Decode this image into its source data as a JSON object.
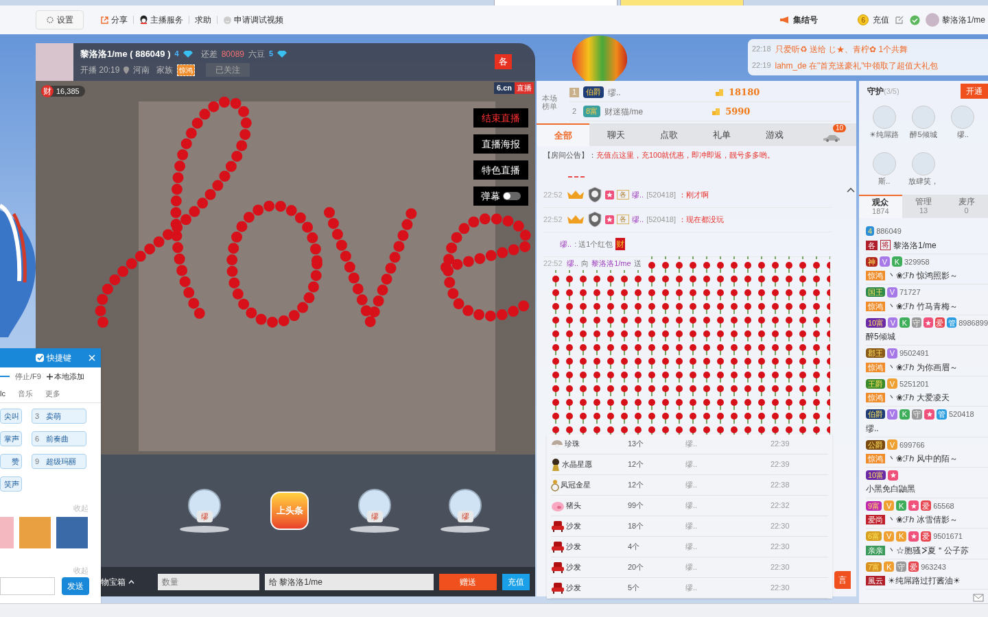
{
  "top_nav": {
    "settings": "设置",
    "links": [
      {
        "kind": "share",
        "label": "分享"
      },
      {
        "kind": "service",
        "label": "主播服务"
      },
      {
        "kind": "plain",
        "label": "求助"
      },
      {
        "kind": "smile",
        "label": "申请调试视频"
      }
    ],
    "rally": "集结号",
    "coin": "6",
    "recharge": "充值",
    "user": "黎洛洛1/me"
  },
  "host": {
    "name": "黎洛洛1/me ( 886049 )",
    "level": "4",
    "gap_label": "还差",
    "gap_value": "80089",
    "gap_unit": "六豆",
    "next_level": "5",
    "start": "开播 20:19",
    "location": "河南",
    "family_label": "家族",
    "family": "惊鸿",
    "follow": "已关注",
    "flag": "各"
  },
  "notifications": [
    {
      "time": "22:18",
      "text": "只爱听♻ 送给 じ★、青柠✿ 1个共舞"
    },
    {
      "time": "22:19",
      "text": "lahm_de 在\"首充送豪礼\"中领取了超值大礼包"
    }
  ],
  "video": {
    "fans_badge": "财",
    "fans": "16,385",
    "logo": "6.cn",
    "logo_tag": "直播",
    "buttons": [
      {
        "label": "结束直播",
        "kind": "red"
      },
      {
        "label": "直播海报",
        "kind": "plain"
      },
      {
        "label": "特色直播",
        "kind": "plain"
      },
      {
        "label": "弹幕",
        "kind": "toggle",
        "on": false
      }
    ]
  },
  "stage": [
    {
      "kind": "avatar",
      "label": "缪"
    },
    {
      "kind": "headline",
      "label": "上头条"
    },
    {
      "kind": "avatar",
      "label": "缪"
    },
    {
      "kind": "avatar",
      "label": "缪"
    }
  ],
  "gift_bar": {
    "box": "物宝箱",
    "quantity_placeholder": "数量",
    "recipient": "给 黎洛洛1/me",
    "send": "赠送",
    "recharge": "充值"
  },
  "ranking": {
    "label": "本场榜单",
    "rows": [
      {
        "rank": "1",
        "badge": {
          "text": "伯爵",
          "color": "#1d3c78"
        },
        "name": "缪..",
        "score": "18180"
      },
      {
        "rank": "2",
        "badge": {
          "text": "8富",
          "color": "#3aa0a0"
        },
        "name": "财迷猫/me",
        "score": "5990"
      }
    ]
  },
  "chat_tabs": [
    {
      "label": "全部",
      "selected": true
    },
    {
      "label": "聊天",
      "selected": false
    },
    {
      "label": "点歌",
      "selected": false
    },
    {
      "label": "礼单",
      "selected": false
    },
    {
      "label": "游戏",
      "selected": false
    }
  ],
  "car_count": "10",
  "announcement": {
    "label": "【房间公告】：",
    "text": "充值点这里，充100就优惠，即冲即返，靓号多多哟。"
  },
  "messages": [
    {
      "kind": "chat",
      "time": "22:52",
      "family": "各",
      "name": "缪..",
      "id": "[520418]",
      "text": "：刚才啊"
    },
    {
      "kind": "chat",
      "time": "22:52",
      "family": "各",
      "name": "缪..",
      "id": "[520418]",
      "text": "：现在都没玩"
    },
    {
      "kind": "redpacket",
      "name": "缪..",
      "text": ": 送1个红包",
      "badge": "财"
    },
    {
      "kind": "gift",
      "time": "22:52",
      "name": "缪..",
      "verb": "向",
      "target": "黎洛洛1/me",
      "text": "送"
    }
  ],
  "send_button": "言",
  "gift_list": [
    {
      "kind": "pearl",
      "name": "珍珠",
      "count": "13个",
      "from": "缪..",
      "time": "22:39"
    },
    {
      "kind": "figure",
      "name": "水晶星愿",
      "count": "12个",
      "from": "缪..",
      "time": "22:39"
    },
    {
      "kind": "ring",
      "name": "凤冠金星",
      "count": "12个",
      "from": "缪..",
      "time": "22:38"
    },
    {
      "kind": "pig",
      "name": "猪头",
      "count": "99个",
      "from": "缪..",
      "time": "22:32"
    },
    {
      "kind": "sofa",
      "name": "沙发",
      "count": "18个",
      "from": "缪..",
      "time": "22:30"
    },
    {
      "kind": "sofa",
      "name": "沙发",
      "count": "4个",
      "from": "缪..",
      "time": "22:30"
    },
    {
      "kind": "sofa",
      "name": "沙发",
      "count": "20个",
      "from": "缪..",
      "time": "22:30"
    },
    {
      "kind": "sofa",
      "name": "沙发",
      "count": "5个",
      "from": "缪..",
      "time": "22:30"
    }
  ],
  "guards": {
    "title": "守护",
    "count": "(3/5)",
    "open": "开通",
    "members": [
      "☀纯屌路",
      "醉5倾城",
      "缪..",
      "斯..",
      "放肆笑，"
    ]
  },
  "audience_tabs": [
    {
      "label": "观众",
      "count": "1874",
      "selected": true
    },
    {
      "label": "管理",
      "count": "13",
      "selected": false
    },
    {
      "label": "麦序",
      "count": "0",
      "selected": false
    }
  ],
  "users": [
    {
      "rank": {
        "text": "4",
        "color": "#2a8fd8"
      },
      "id": "886049",
      "family": {
        "text": "各",
        "color": "#b01e2a"
      },
      "title": "将",
      "name": [
        {
          "text": "黎洛洛1/me"
        }
      ]
    },
    {
      "rank": {
        "text": "神",
        "color": "#b0281e"
      },
      "tags": [
        {
          "text": "V",
          "color": "#a678e8"
        },
        {
          "text": "K",
          "color": "#3fae5a"
        }
      ],
      "id": "329958",
      "family": {
        "text": "惊鸿",
        "color": "#f08c2a"
      },
      "name": [
        {
          "text": "丶❀ℱℎ 惊鸿照影～"
        }
      ]
    },
    {
      "rank": {
        "text": "国王",
        "color": "#2e8a4a"
      },
      "tags": [
        {
          "text": "V",
          "color": "#a678e8"
        }
      ],
      "id": "71727",
      "family": {
        "text": "惊鸿",
        "color": "#f08c2a"
      },
      "name": [
        {
          "text": "丶❀ℱℎ 竹马青梅～"
        }
      ]
    },
    {
      "rank": {
        "text": "10富",
        "color": "#6a2aa8"
      },
      "tags": [
        {
          "text": "V",
          "color": "#a678e8"
        },
        {
          "text": "K",
          "color": "#3fae5a"
        },
        {
          "text": "守",
          "color": "#9a9a9a"
        },
        {
          "text": "★",
          "color": "#f0507a"
        },
        {
          "text": "爱",
          "color": "#e8464e"
        },
        {
          "text": "管",
          "color": "#2a9ee0"
        }
      ],
      "id": "8986899",
      "name": [
        {
          "text": "醉5倾城"
        }
      ]
    },
    {
      "rank": {
        "text": "郡王",
        "color": "#8a5a1a"
      },
      "tags": [
        {
          "text": "V",
          "color": "#a678e8"
        }
      ],
      "id": "9502491",
      "family": {
        "text": "惊鸿",
        "color": "#f08c2a"
      },
      "name": [
        {
          "text": "丶❀ℱℎ 为你画眉～"
        }
      ]
    },
    {
      "rank": {
        "text": "王爵",
        "color": "#3a8a2a"
      },
      "tags": [
        {
          "text": "V",
          "color": "#f0a030"
        }
      ],
      "id": "5251201",
      "family": {
        "text": "惊鸿",
        "color": "#f08c2a"
      },
      "name": [
        {
          "text": "丶❀ℱℎ 大爱凌天"
        }
      ]
    },
    {
      "rank": {
        "text": "伯爵",
        "color": "#1d3c78"
      },
      "tags": [
        {
          "text": "V",
          "color": "#a678e8"
        },
        {
          "text": "K",
          "color": "#3fae5a"
        },
        {
          "text": "守",
          "color": "#9a9a9a"
        },
        {
          "text": "★",
          "color": "#f0507a"
        },
        {
          "text": "管",
          "color": "#2a9ee0"
        }
      ],
      "id": "520418",
      "name": [
        {
          "text": "缪.."
        }
      ]
    },
    {
      "rank": {
        "text": "公爵",
        "color": "#7a4a10"
      },
      "tags": [
        {
          "text": "V",
          "color": "#f0a030"
        }
      ],
      "id": "699766",
      "family": {
        "text": "惊鸿",
        "color": "#f08c2a"
      },
      "name": [
        {
          "text": "丶❀ℱℎ 风中的陌～"
        }
      ]
    },
    {
      "rank": {
        "text": "10富",
        "color": "#6a2aa8"
      },
      "tags": [
        {
          "text": "★",
          "color": "#f0507a"
        }
      ],
      "name": [
        {
          "text": "小黑免白鼬黑"
        }
      ]
    },
    {
      "rank": {
        "text": "9富",
        "color": "#c02ab0"
      },
      "tags": [
        {
          "text": "V",
          "color": "#f0a030"
        },
        {
          "text": "K",
          "color": "#3fae5a"
        },
        {
          "text": "★",
          "color": "#f0507a"
        },
        {
          "text": "爱",
          "color": "#e8464e"
        }
      ],
      "id": "65568",
      "family": {
        "text": "爱尚",
        "color": "#c0202a"
      },
      "name": [
        {
          "text": "丶❀ℱℎ 冰雪倩影～"
        }
      ]
    },
    {
      "rank": {
        "text": "6富",
        "color": "#d8a020"
      },
      "tags": [
        {
          "text": "V",
          "color": "#f0a030"
        },
        {
          "text": "K",
          "color": "#f0a030"
        },
        {
          "text": "★",
          "color": "#f0507a"
        },
        {
          "text": "爱",
          "color": "#e8464e"
        }
      ],
      "id": "9501671",
      "family": {
        "text": "亲亲",
        "color": "#3a9a5a"
      },
      "name": [
        {
          "text": "丶☆胞骚"
        },
        {
          "kind": "squiggle"
        },
        {
          "text": "夏＂公子苏"
        }
      ]
    },
    {
      "rank": {
        "text": "7富",
        "color": "#d89020"
      },
      "tags": [
        {
          "text": "K",
          "color": "#f0a030"
        },
        {
          "text": "守",
          "color": "#9a9a9a"
        },
        {
          "text": "爱",
          "color": "#e8464e"
        }
      ],
      "id": "963243",
      "family": {
        "text": "風云",
        "color": "#b01e2a"
      },
      "name": [
        {
          "text": "☀纯屌路过打酱油☀"
        }
      ]
    }
  ],
  "shortcut_panel": {
    "title": "快捷键",
    "enabled": true,
    "stop": "停止/F9",
    "add": "本地添加",
    "tabs": [
      {
        "label": "lc",
        "selected": true
      },
      {
        "label": "音乐",
        "selected": false
      },
      {
        "label": "更多",
        "selected": false
      }
    ],
    "sounds": [
      {
        "label": "尖叫"
      },
      {
        "key": "3",
        "label": "卖萌"
      },
      {
        "label": "掌声"
      },
      {
        "key": "6",
        "label": "前奏曲"
      },
      {
        "label": "赞"
      },
      {
        "key": "9",
        "label": "超级玛丽"
      },
      {
        "label": "笑声"
      }
    ],
    "collapse": "收起",
    "collapse_2": "收起",
    "send": "发送"
  }
}
